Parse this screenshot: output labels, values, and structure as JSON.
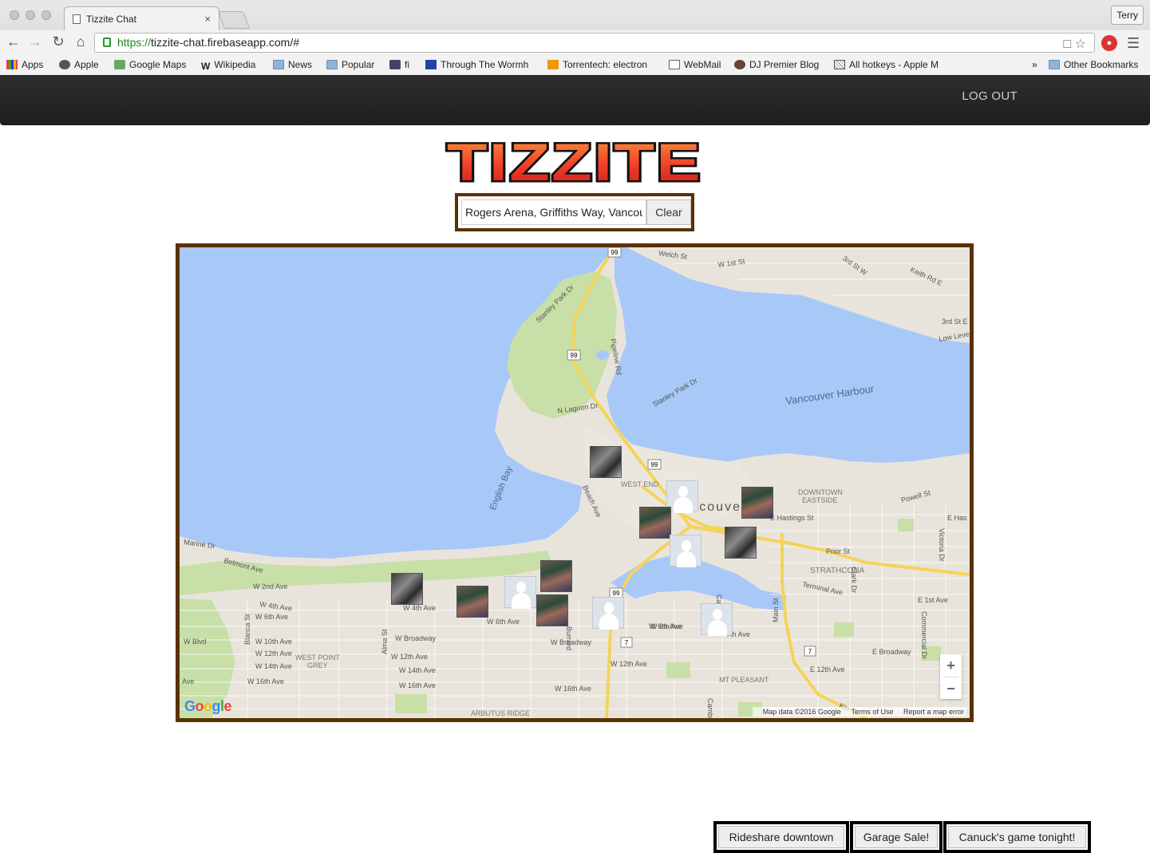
{
  "browser": {
    "tab_title": "Tizzite Chat",
    "tab_close": "×",
    "profile": "Terry",
    "url_scheme": "https://",
    "url_rest": "tizzite-chat.firebaseapp.com/#",
    "bookmarks": [
      {
        "label": "Apps",
        "icon": "apps-grid-icon"
      },
      {
        "label": "Apple",
        "icon": "apple-icon"
      },
      {
        "label": "Google Maps",
        "icon": "google-maps-icon"
      },
      {
        "label": "Wikipedia",
        "icon": "wikipedia-icon"
      },
      {
        "label": "News",
        "icon": "folder-icon"
      },
      {
        "label": "Popular",
        "icon": "folder-icon"
      },
      {
        "label": "fi",
        "icon": "shield-icon"
      },
      {
        "label": "Through The Wormh",
        "icon": "site-icon"
      },
      {
        "label": "Torrentech: electron",
        "icon": "site-icon"
      },
      {
        "label": "WebMail",
        "icon": "document-icon"
      },
      {
        "label": "DJ Premier Blog",
        "icon": "site-icon"
      },
      {
        "label": "All hotkeys - Apple M",
        "icon": "grid-icon"
      },
      {
        "label": "»",
        "icon": ""
      },
      {
        "label": "Other Bookmarks",
        "icon": "folder-icon"
      }
    ]
  },
  "app": {
    "logout_label": "LOG OUT",
    "logo_text": "TIZZITE",
    "search": {
      "value": "Rogers Arena, Griffiths Way, Vancouver",
      "clear_label": "Clear"
    }
  },
  "map": {
    "labels": {
      "vancouver_harbour": "Vancouver Harbour",
      "english_bay": "English Bay",
      "west_end": "WEST END",
      "downtown_eastside_1": "DOWNTOWN",
      "downtown_eastside_2": "EASTSIDE",
      "strathcona": "STRATHCONA",
      "west_point_grey_1": "WEST POINT",
      "west_point_grey_2": "GREY",
      "mt_pleasant": "MT PLEASANT",
      "arbutus_ridge": "ARBUTUS RIDGE",
      "vancouver": "Vancouver",
      "stanley_park_dr": "Stanley Park Dr",
      "stanley_park_dr_2": "Stanley Park Dr",
      "pipeline_rd": "Pipeline Rd",
      "n_lagoon_dr": "N Lagoon Dr",
      "beach_ave": "Beach Ave",
      "e_hastings": "E Hastings St",
      "prior_st": "Prior St",
      "terminal_ave": "Terminal Ave",
      "w_4th_ave": "W 4th Ave",
      "w_broadway": "W Broadway",
      "w_broadway_2": "W Broadway",
      "w_12th_ave": "W 12th Ave",
      "w_16th_ave": "W 16th Ave",
      "w_16th_ave_2": "W 16th Ave",
      "w_16th_ave_3": "W 16th Ave",
      "w_6th_ave": "W 6th Ave",
      "w_6th_ave_2": "W 6th Ave",
      "w_6th_ave_3": "W 6th Ave",
      "e_broadway": "E Broadway",
      "e_12th_ave": "E 12th Ave",
      "e_1st_ave": "E 1st Ave",
      "powell_st": "Powell St",
      "marine_dr": "Marine Dr",
      "belmont_ave": "Belmont Ave",
      "w_2nd_ave": "W 2nd Ave",
      "w_4th_ave_2": "W 4th Ave",
      "w_10th_ave": "W 10th Ave",
      "w_12th_ave_2": "W 12th Ave",
      "w_14th_ave": "W 14th Ave",
      "w_12th_ave_3": "W 12th Ave",
      "w_14th_ave_2": "W 14th Ave",
      "welch_st": "Welch St",
      "w_1st_st": "W 1st St",
      "3rd_st_w": "3rd St W",
      "keith_rd_e": "Keith Rd E",
      "3rd_st_e": "3rd St E",
      "low_level": "Low Leve",
      "main_st": "Main St",
      "clark_dr": "Clark Dr",
      "victoria_dr": "Victoria Dr",
      "commercial_dr": "Commercial Dr",
      "e_has": "E Has",
      "alma_st": "Alma St",
      "blanca_st": "Blanca St",
      "w_blvd": "W Blvd",
      "ave": "Ave",
      "hwy_99": "99",
      "hwy_7": "7",
      "stanley_park_dr_3": "Stanley Park Dr",
      "th_ave": "7th Ave",
      "w_6th_ave_4": "W 6th Ave",
      "kin": "Kin",
      "cambie": "Cambi",
      "burrard": "Burrard",
      "ca": "Ca"
    },
    "zoom_in": "+",
    "zoom_out": "−",
    "google": "Google",
    "footer_data": "Map data ©2016 Google",
    "footer_terms": "Terms of Use",
    "footer_report": "Report a map error",
    "colors": {
      "water": "#a8c8f8",
      "park": "#c8dfa8",
      "land": "#e8e4dc",
      "highway": "#f5d35a",
      "border": "#5a3200"
    }
  },
  "topics": [
    {
      "label": "Rideshare downtown"
    },
    {
      "label": "Garage Sale!"
    },
    {
      "label": "Canuck's game tonight!"
    }
  ]
}
